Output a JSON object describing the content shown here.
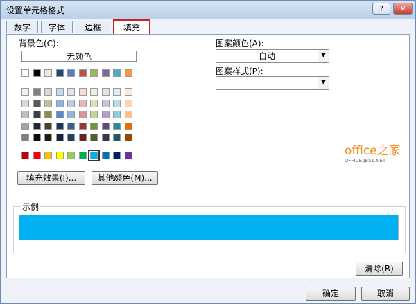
{
  "window": {
    "title": "设置单元格格式",
    "help_icon": "?",
    "close_icon": "✕"
  },
  "tabs": [
    {
      "label": "数字",
      "active": false
    },
    {
      "label": "字体",
      "active": false
    },
    {
      "label": "边框",
      "active": false
    },
    {
      "label": "填充",
      "active": true
    }
  ],
  "fill": {
    "background_label": "背景色(C):",
    "no_color_label": "无颜色",
    "fill_effects_button": "填充效果(I)...",
    "other_colors_button": "其他颜色(M)...",
    "row1_colors": [
      "#ffffff",
      "#000000",
      "#eeece1",
      "#1f497d",
      "#4f81bd",
      "#c0504d",
      "#9bbb59",
      "#8064a2",
      "#4bacc6",
      "#f79646"
    ],
    "grid_colors": [
      [
        "#f2f2f2",
        "#7f7f7f",
        "#ddd9c3",
        "#c6d9f0",
        "#dbe5f1",
        "#f2dcdb",
        "#ebf1dd",
        "#e5e0ec",
        "#dbeef3",
        "#fdeada"
      ],
      [
        "#d8d8d8",
        "#595959",
        "#c4bd97",
        "#8db3e2",
        "#b8cce4",
        "#e5b9b7",
        "#d7e3bc",
        "#ccc1d9",
        "#b7dde8",
        "#fbd5b5"
      ],
      [
        "#bfbfbf",
        "#3f3f3f",
        "#938953",
        "#548dd4",
        "#95b3d7",
        "#d99694",
        "#c3d69b",
        "#b2a2c7",
        "#92cddc",
        "#fac08f"
      ],
      [
        "#a5a5a5",
        "#262626",
        "#494429",
        "#17365d",
        "#366092",
        "#953734",
        "#76923c",
        "#5f497a",
        "#31859b",
        "#e36c09"
      ],
      [
        "#7f7f7f",
        "#0c0c0c",
        "#1d1b10",
        "#0f243e",
        "#244061",
        "#632423",
        "#4f6128",
        "#3f3151",
        "#205867",
        "#974806"
      ]
    ],
    "standard_colors": [
      "#c00000",
      "#ff0000",
      "#ffc000",
      "#ffff00",
      "#92d050",
      "#00b050",
      "#00b0f0",
      "#0070c0",
      "#002060",
      "#7030a0"
    ],
    "selected_standard_index": 6,
    "pattern_color_label": "图案颜色(A):",
    "pattern_color_value": "自动",
    "pattern_style_label": "图案样式(P):",
    "pattern_style_value": "",
    "dropdown_arrow": "▼"
  },
  "sample": {
    "label": "示例",
    "color": "#00b0f0"
  },
  "buttons": {
    "clear": "清除(R)",
    "ok": "确定",
    "cancel": "取消"
  },
  "watermark": {
    "brand": "office之家",
    "url": "OFFICE.JB51.NET"
  }
}
